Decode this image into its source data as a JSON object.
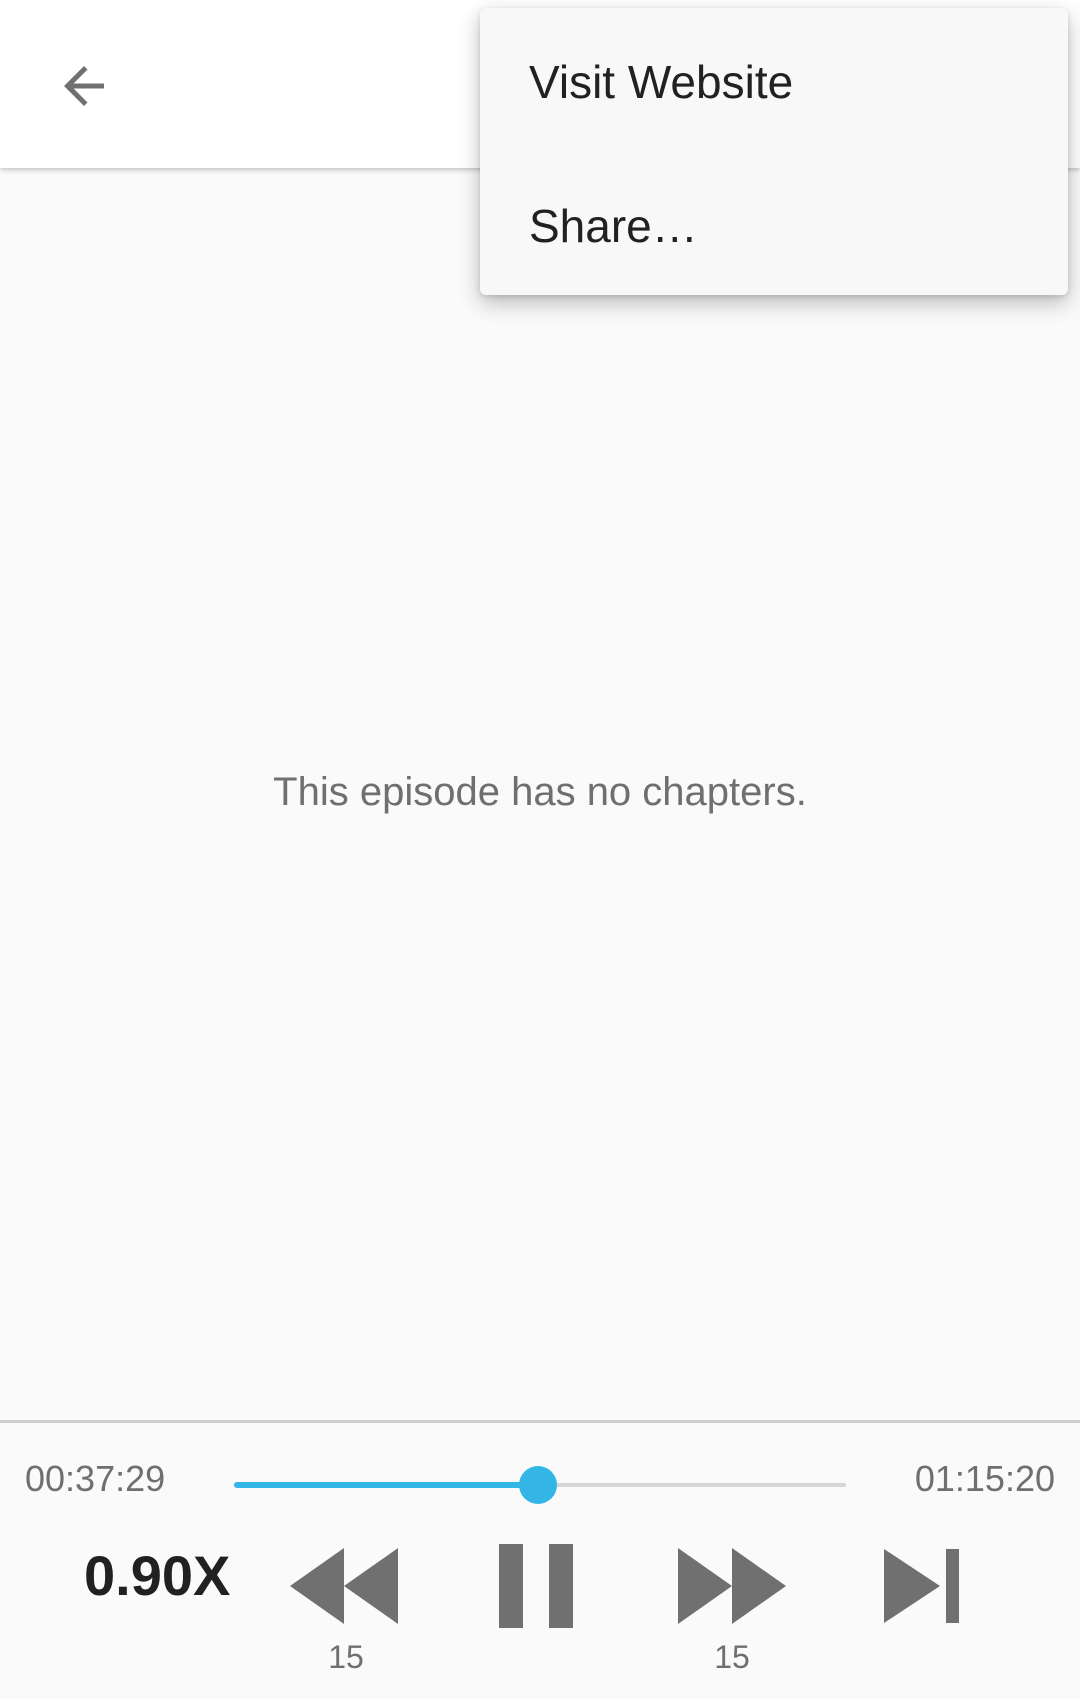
{
  "menu": {
    "items": [
      {
        "label": "Visit Website"
      },
      {
        "label": "Share…"
      }
    ]
  },
  "main": {
    "empty_text": "This episode has no chapters."
  },
  "player": {
    "current_time": "00:37:29",
    "duration": "01:15:20",
    "progress_fraction": 0.497,
    "speed": "0.90X",
    "rewind_seconds": "15",
    "forward_seconds": "15",
    "accent_color": "#33b5e5",
    "icons": {
      "back": "arrow-left-icon",
      "rewind": "rewind-icon",
      "pause": "pause-icon",
      "forward": "fast-forward-icon",
      "skip": "skip-next-icon"
    }
  }
}
